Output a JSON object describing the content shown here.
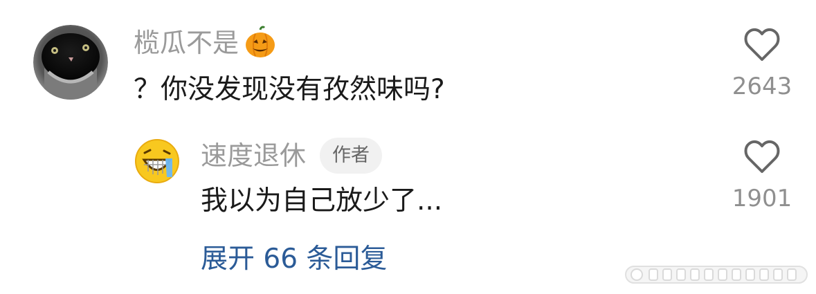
{
  "comment": {
    "author": "榄瓜不是",
    "text": "？你没发现没有孜然味吗?",
    "likes": "2643"
  },
  "reply": {
    "author": "速度退休",
    "badge": "作者",
    "text": "我以为自己放少了...",
    "likes": "1901"
  },
  "more_replies": {
    "label": "展开 66 条回复"
  },
  "colors": {
    "text": "#1a1a1a",
    "muted": "#9a9a9a",
    "link": "#2b5b97",
    "badge_bg": "#f1f1f1"
  },
  "icons": {
    "like": "heart-outline-icon",
    "emoji": "pumpkin-icon"
  }
}
